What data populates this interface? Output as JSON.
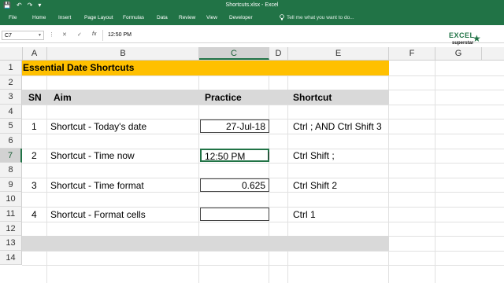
{
  "window": {
    "title": "Shortcuts.xlsx - Excel"
  },
  "ribbon": {
    "tabs": [
      "File",
      "Home",
      "Insert",
      "Page Layout",
      "Formulas",
      "Data",
      "Review",
      "View",
      "Developer"
    ],
    "tell_me": "Tell me what you want to do..."
  },
  "formula_bar": {
    "name_box": "C7",
    "content": "12:50 PM"
  },
  "logo": {
    "line1": "EXCEL",
    "line2": "superstar"
  },
  "columns": [
    "A",
    "B",
    "C",
    "D",
    "E",
    "F",
    "G"
  ],
  "selected_column": "C",
  "rows": [
    "1",
    "2",
    "3",
    "4",
    "5",
    "6",
    "7",
    "8",
    "9",
    "10",
    "11",
    "12",
    "13",
    "14"
  ],
  "selected_row": "7",
  "sheet": {
    "title": "Essential Date Shortcuts",
    "headers": {
      "sn": "SN",
      "aim": "Aim",
      "practice": "Practice",
      "shortcut": "Shortcut"
    },
    "items": [
      {
        "sn": "1",
        "aim": "Shortcut - Today's date",
        "practice": "27-Jul-18",
        "shortcut": "Ctrl ; AND Ctrl Shift 3"
      },
      {
        "sn": "2",
        "aim": "Shortcut - Time now",
        "practice": "12:50 PM",
        "shortcut": "Ctrl Shift ;"
      },
      {
        "sn": "3",
        "aim": "Shortcut - Time format",
        "practice": "0.625",
        "shortcut": "Ctrl Shift 2"
      },
      {
        "sn": "4",
        "aim": "Shortcut - Format cells",
        "practice": "",
        "shortcut": "Ctrl 1"
      }
    ]
  },
  "colors": {
    "excel_green": "#217346",
    "title_fill": "#ffc000",
    "band_fill": "#d9d9d9"
  }
}
